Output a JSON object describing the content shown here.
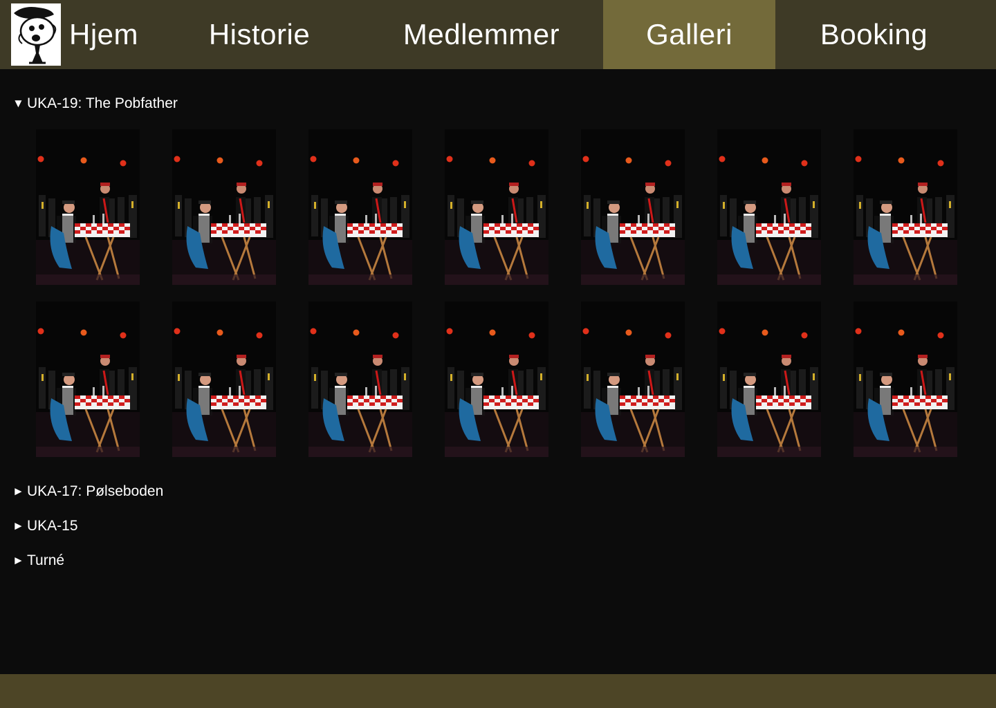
{
  "nav": {
    "items": [
      {
        "key": "hjem",
        "label": "Hjem",
        "active": false
      },
      {
        "key": "historie",
        "label": "Historie",
        "active": false
      },
      {
        "key": "medlemmer",
        "label": "Medlemmer",
        "active": false
      },
      {
        "key": "galleri",
        "label": "Galleri",
        "active": true
      },
      {
        "key": "booking",
        "label": "Booking",
        "active": false
      }
    ]
  },
  "sections": [
    {
      "title": "UKA-19: The Pobfather",
      "expanded": true,
      "marker": "▼",
      "photo_count": 14
    },
    {
      "title": "UKA-17: Pølseboden",
      "expanded": false,
      "marker": "►"
    },
    {
      "title": "UKA-15",
      "expanded": false,
      "marker": "►"
    },
    {
      "title": "Turné",
      "expanded": false,
      "marker": "►"
    }
  ],
  "colors": {
    "nav_bg": "#3e3a26",
    "nav_active": "#736a3a",
    "page_bg": "#0c0c0c",
    "footer_bg": "#4d4526"
  },
  "icons": {
    "logo": "cartoon-face-logo",
    "expanded_marker": "triangle-down",
    "collapsed_marker": "triangle-right"
  }
}
